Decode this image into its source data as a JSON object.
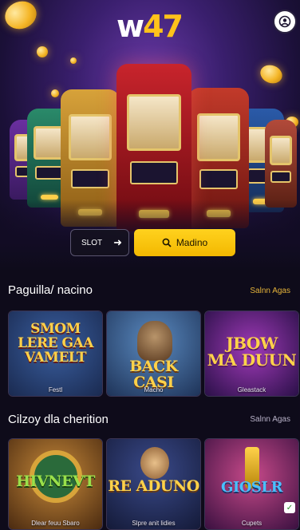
{
  "header": {
    "logo_letter": "w",
    "logo_number": "47",
    "profile_icon": "user-circle-icon"
  },
  "hero": {
    "slot_label": "SLOT",
    "slot_arrow": "➜",
    "play_label": "Madino",
    "play_icon": "search-icon"
  },
  "sections": [
    {
      "title": "Paguilla/ nacino",
      "see_all": "Salnn Agas",
      "cards": [
        {
          "art": "SMOM\nLERE GAA\nVAMELT",
          "caption": "Festl"
        },
        {
          "art": "BACK CASI",
          "caption": "Macho"
        },
        {
          "art": "JBOW\nMA DUUN",
          "caption": "Gleastack"
        }
      ]
    },
    {
      "title": "Cilzoy dla cherition",
      "see_all": "Salnn Agas",
      "cards": [
        {
          "art": "HIVNEVT",
          "caption": "Dlear feuu Sbaro"
        },
        {
          "art": "RE ADUNO",
          "caption": "Slpre anit lidies"
        },
        {
          "art": "GIOSLR",
          "caption": "Cupets"
        }
      ]
    }
  ],
  "colors": {
    "accent": "#ffc21a",
    "background": "#0e0b1a",
    "link": "#e6b43a"
  }
}
